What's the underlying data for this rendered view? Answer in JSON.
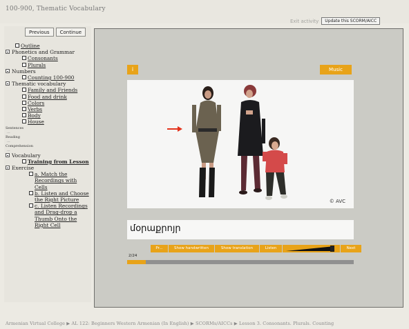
{
  "page": {
    "title": "100-900, Thematic Vocabulary"
  },
  "sidebar": {
    "previous_label": "Previous",
    "continue_label": "Continue",
    "tree": {
      "outline": "Outline",
      "phonetics": "Phonetics and Grammar",
      "consonants": "Consonants",
      "plurals": "Plurals",
      "numbers": "Numbers",
      "counting": "Counting 100-900",
      "thematic": "Thematic vocabulary",
      "family": "Family and Friends",
      "food": "Food and drink",
      "colors": "Colors",
      "verbs": "Verbs",
      "body": "Body",
      "house": "House",
      "sentences": "Sentences",
      "reading": "Reading",
      "comprehension": "Comprehension",
      "vocabulary": "Vocabulary",
      "training": "Training from Lesson",
      "exercise": "Exercise",
      "ex_a": "a. Match the Recordings with Cells",
      "ex_b": "b. Listen and Choose the Right Picture",
      "ex_c": "c. Listen Recordings and Drag-drop a Thumb Onto the Right Cell"
    }
  },
  "toolbar": {
    "exit_label": "Exit activity",
    "scorm_label": "Update this SCORM/AICC"
  },
  "activity": {
    "info_label": "i",
    "music_label": "Music",
    "copyright": "© AVC",
    "word": "մօրաքրոյր",
    "controls": {
      "previous": "Pr...",
      "handwritten": "Show handwritten",
      "translation": "Show translation",
      "listen": "Listen",
      "next": "Next"
    },
    "progress": {
      "label": "2/24",
      "fraction": 0.083
    }
  },
  "footer": {
    "breadcrumb": "Armenian Virtual College ▶ AL 122: Beginners Western Armenian (In English) ▶ SCORMs/AICCs ▶ Lesson 3. Consonants. Plurals. Counting"
  },
  "colors": {
    "accent": "#e8a319",
    "panel": "#cbcbc5",
    "background": "#eceae3",
    "arrow": "#e4321b"
  }
}
